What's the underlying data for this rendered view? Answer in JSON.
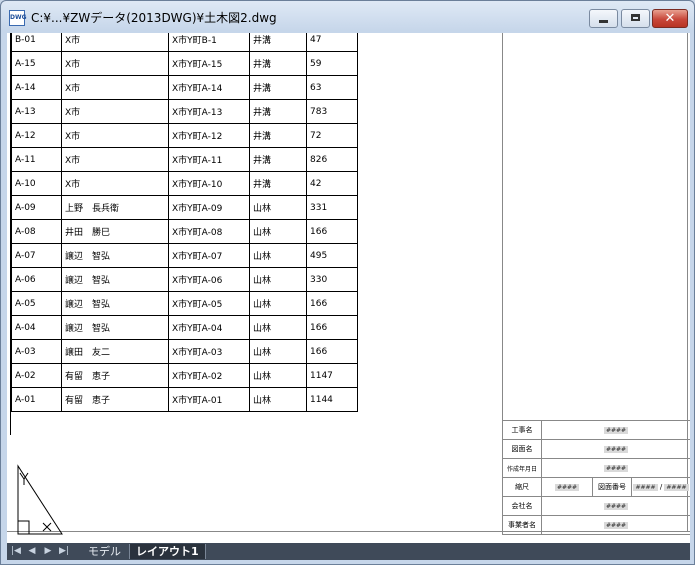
{
  "window": {
    "title": "C:¥...¥ZWデータ(2013DWG)¥土木図2.dwg",
    "app_icon": "DWG"
  },
  "table": {
    "rows": [
      [
        "B-01",
        "X市",
        "X市Y町B-1",
        "井溝",
        "47"
      ],
      [
        "A-15",
        "X市",
        "X市Y町A-15",
        "井溝",
        "59"
      ],
      [
        "A-14",
        "X市",
        "X市Y町A-14",
        "井溝",
        "63"
      ],
      [
        "A-13",
        "X市",
        "X市Y町A-13",
        "井溝",
        "783"
      ],
      [
        "A-12",
        "X市",
        "X市Y町A-12",
        "井溝",
        "72"
      ],
      [
        "A-11",
        "X市",
        "X市Y町A-11",
        "井溝",
        "826"
      ],
      [
        "A-10",
        "X市",
        "X市Y町A-10",
        "井溝",
        "42"
      ],
      [
        "A-09",
        "上野　長兵衛",
        "X市Y町A-09",
        "山林",
        "331"
      ],
      [
        "A-08",
        "井田　勝巳",
        "X市Y町A-08",
        "山林",
        "166"
      ],
      [
        "A-07",
        "譲辺　智弘",
        "X市Y町A-07",
        "山林",
        "495"
      ],
      [
        "A-06",
        "譲辺　智弘",
        "X市Y町A-06",
        "山林",
        "330"
      ],
      [
        "A-05",
        "譲辺　智弘",
        "X市Y町A-05",
        "山林",
        "166"
      ],
      [
        "A-04",
        "譲辺　智弘",
        "X市Y町A-04",
        "山林",
        "166"
      ],
      [
        "A-03",
        "譲田　友二",
        "X市Y町A-03",
        "山林",
        "166"
      ],
      [
        "A-02",
        "有留　恵子",
        "X市Y町A-02",
        "山林",
        "1147"
      ],
      [
        "A-01",
        "有留　恵子",
        "X市Y町A-01",
        "山林",
        "1144"
      ]
    ]
  },
  "title_block": {
    "project_label": "工事名",
    "project_value": "####",
    "drawing_label": "図面名",
    "drawing_value": "####",
    "date_label": "作成年月日",
    "date_value": "####",
    "scale_label": "縮尺",
    "scale_value": "####",
    "number_label": "図面番号",
    "number_value": "####",
    "number_sep": "/",
    "number_total": "####",
    "company_label": "会社名",
    "company_value": "####",
    "contractor_label": "事業者名",
    "contractor_value": "####"
  },
  "tabs": {
    "model": "モデル",
    "layout": "レイアウト1"
  },
  "nav": {
    "first": "|◀",
    "prev": "◀",
    "next": "▶",
    "last": "▶|"
  }
}
